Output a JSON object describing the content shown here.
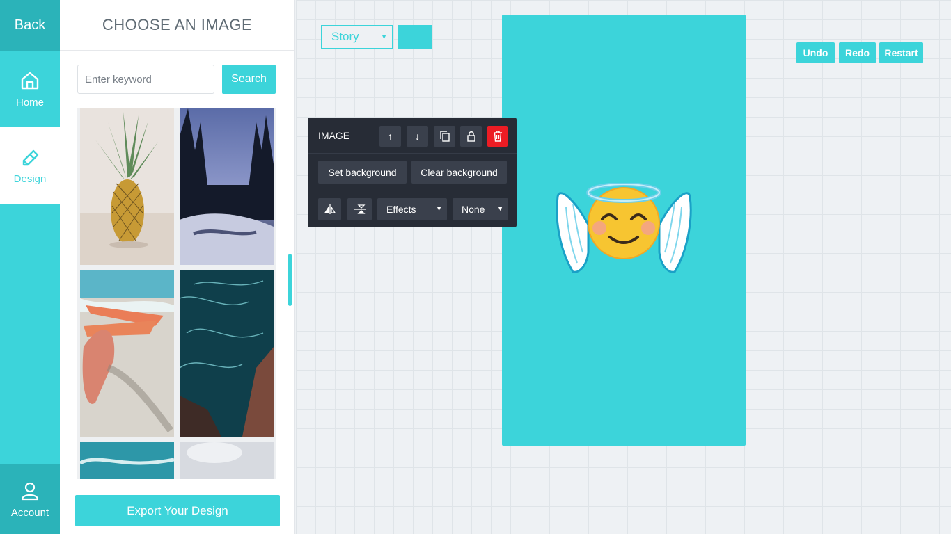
{
  "nav": {
    "back": "Back",
    "home": "Home",
    "design": "Design",
    "account": "Account"
  },
  "panel": {
    "title": "CHOOSE AN IMAGE",
    "search_placeholder": "Enter keyword",
    "search_button": "Search",
    "export_button": "Export Your Design"
  },
  "canvas": {
    "format": "Story",
    "background_color": "#3cd4da"
  },
  "actions": {
    "undo": "Undo",
    "redo": "Redo",
    "restart": "Restart"
  },
  "toolbar": {
    "label": "IMAGE",
    "move_up": "↑",
    "move_down": "↓",
    "set_background": "Set background",
    "clear_background": "Clear background",
    "effects": "Effects",
    "filter": "None"
  },
  "colors": {
    "accent": "#3cd4da",
    "accent_dark": "#2bb3b9",
    "toolbar_bg": "#272c36",
    "delete": "#ec1c24"
  }
}
